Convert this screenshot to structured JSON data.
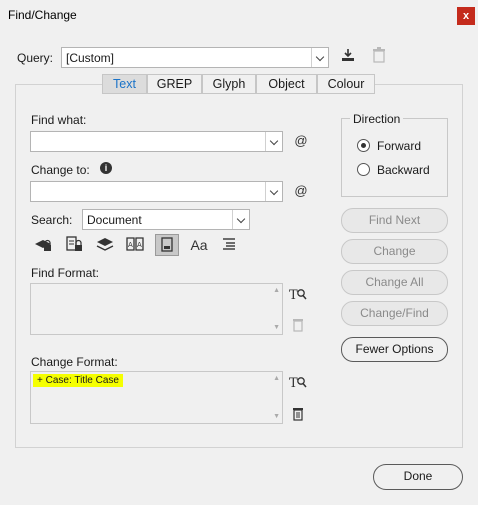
{
  "window": {
    "title": "Find/Change",
    "close_glyph": "x"
  },
  "query": {
    "label": "Query:",
    "value": "[Custom]"
  },
  "tabs": [
    "Text",
    "GREP",
    "Glyph",
    "Object",
    "Colour"
  ],
  "find_what": {
    "label": "Find what:",
    "value": ""
  },
  "change_to": {
    "label": "Change to:",
    "value": "",
    "info_glyph": "i"
  },
  "search": {
    "label": "Search:",
    "value": "Document"
  },
  "find_format": {
    "label": "Find Format:"
  },
  "change_format": {
    "label": "Change Format:",
    "value": "+ Case: Title Case"
  },
  "direction": {
    "label": "Direction",
    "options": [
      "Forward",
      "Backward"
    ],
    "selected": "Forward"
  },
  "buttons": {
    "find_next": "Find Next",
    "change": "Change",
    "change_all": "Change All",
    "change_find": "Change/Find",
    "fewer_options": "Fewer Options",
    "done": "Done"
  },
  "icons": {
    "at_symbol": "@",
    "case_option": "Aa",
    "text_format_search": "T"
  },
  "colors": {
    "accent": "#1a73c8",
    "highlight": "#f5ff00",
    "close": "#c42b1c"
  }
}
